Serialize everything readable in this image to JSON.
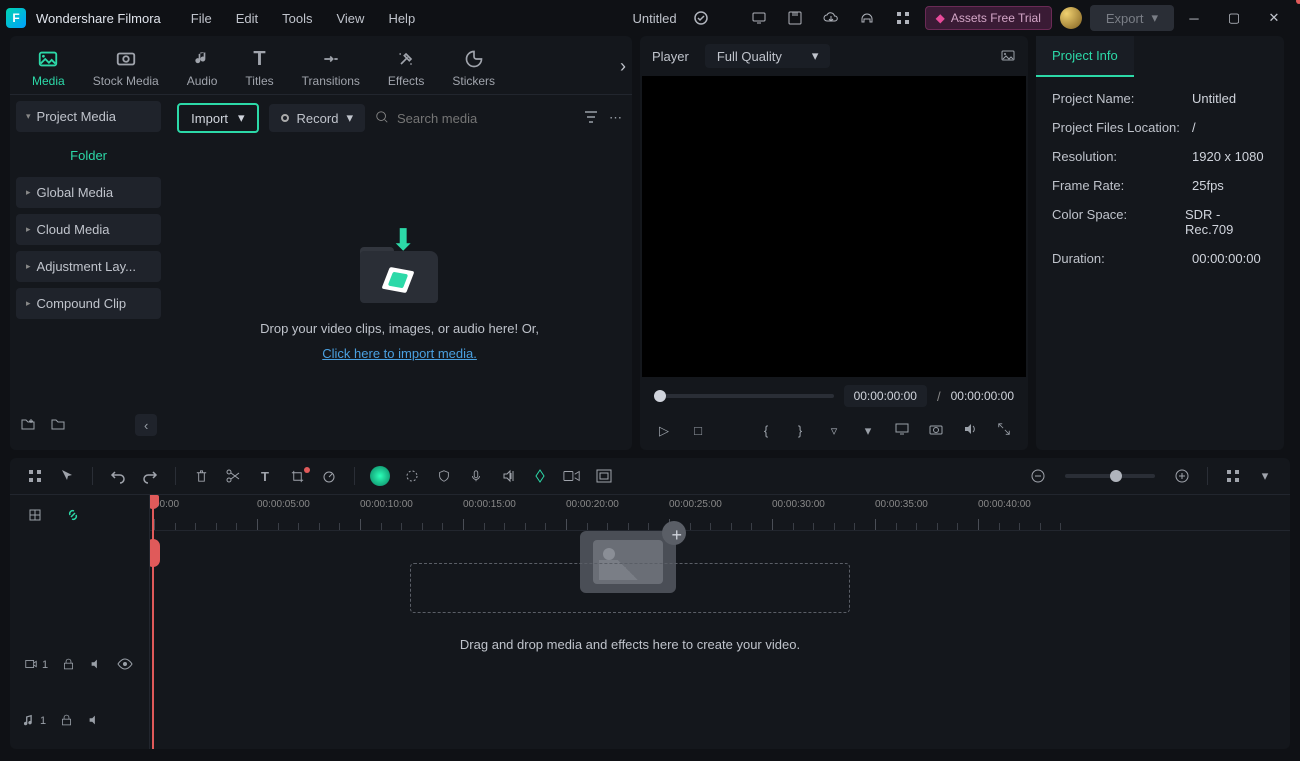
{
  "app": {
    "title": "Wondershare Filmora",
    "document": "Untitled"
  },
  "menu": [
    "File",
    "Edit",
    "Tools",
    "View",
    "Help"
  ],
  "titlebar": {
    "assets": "Assets Free Trial",
    "export": "Export"
  },
  "tabs": [
    "Media",
    "Stock Media",
    "Audio",
    "Titles",
    "Transitions",
    "Effects",
    "Stickers"
  ],
  "sidebar": {
    "project": "Project Media",
    "folder": "Folder",
    "items": [
      "Global Media",
      "Cloud Media",
      "Adjustment Lay...",
      "Compound Clip"
    ]
  },
  "mediaToolbar": {
    "import": "Import",
    "record": "Record",
    "searchPlaceholder": "Search media"
  },
  "dropZone": {
    "line1": "Drop your video clips, images, or audio here! Or,",
    "link": "Click here to import media."
  },
  "player": {
    "label": "Player",
    "quality": "Full Quality",
    "current": "00:00:00:00",
    "sep": "/",
    "total": "00:00:00:00"
  },
  "projectInfo": {
    "tab": "Project Info",
    "rows": [
      {
        "label": "Project Name:",
        "value": "Untitled"
      },
      {
        "label": "Project Files Location:",
        "value": "/"
      },
      {
        "label": "Resolution:",
        "value": "1920 x 1080"
      },
      {
        "label": "Frame Rate:",
        "value": "25fps"
      },
      {
        "label": "Color Space:",
        "value": "SDR - Rec.709"
      },
      {
        "label": "Duration:",
        "value": "00:00:00:00"
      }
    ]
  },
  "timeline": {
    "ticks": [
      "00:00",
      "00:00:05:00",
      "00:00:10:00",
      "00:00:15:00",
      "00:00:20:00",
      "00:00:25:00",
      "00:00:30:00",
      "00:00:35:00",
      "00:00:40:00"
    ],
    "dropHint": "Drag and drop media and effects here to create your video.",
    "track1": "1",
    "track2": "1"
  }
}
